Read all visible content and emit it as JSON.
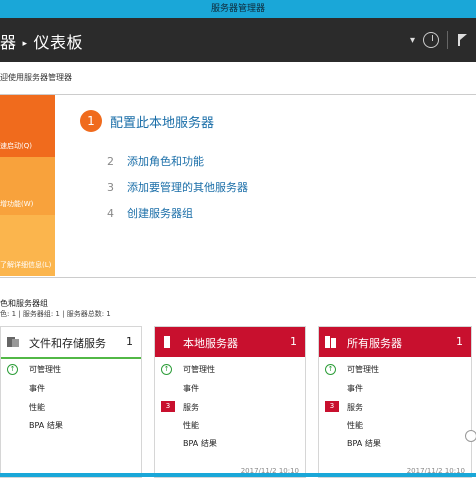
{
  "window": {
    "title": "服务器管理器"
  },
  "nav": {
    "breadcrumb_parent": "器",
    "breadcrumb_sep": "▸",
    "breadcrumb_current": "仪表板",
    "dropdown_glyph": "▾",
    "icons": [
      "refresh-icon",
      "flag-icon"
    ]
  },
  "welcome": {
    "label": "迎使用服务器管理器",
    "tiles": [
      "速启动(Q)",
      "增功能(W)",
      "了解详细信息(L)"
    ],
    "steps": [
      {
        "num": "1",
        "label": "配置此本地服务器"
      },
      {
        "num": "2",
        "label": "添加角色和功能"
      },
      {
        "num": "3",
        "label": "添加要管理的其他服务器"
      },
      {
        "num": "4",
        "label": "创建服务器组"
      }
    ]
  },
  "roles": {
    "heading": "色和服务器组",
    "summary": "色: 1 | 服务器组: 1 | 服务器总数: 1"
  },
  "cards": [
    {
      "title": "文件和存储服务",
      "count": "1",
      "rows": [
        "可管理性",
        "事件",
        "性能",
        "BPA 结果"
      ],
      "timestamp": ""
    },
    {
      "title": "本地服务器",
      "count": "1",
      "rows": [
        "可管理性",
        "事件",
        "服务",
        "性能",
        "BPA 结果"
      ],
      "service_badge": "3",
      "timestamp": "2017/11/2 10:10"
    },
    {
      "title": "所有服务器",
      "count": "1",
      "rows": [
        "可管理性",
        "事件",
        "服务",
        "性能",
        "BPA 结果"
      ],
      "service_badge": "3",
      "timestamp": "2017/11/2 10:10"
    }
  ],
  "colors": {
    "title_bar": "#1aa7d8",
    "nav_bar": "#2b2b2b",
    "accent_orange": "#f06b1d",
    "card_red": "#c8102e",
    "ok_green": "#2e9e3a",
    "link_blue": "#1a6ea8"
  }
}
